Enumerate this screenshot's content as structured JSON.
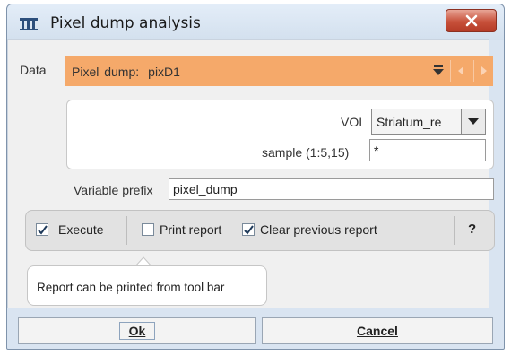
{
  "window": {
    "title": "Pixel dump analysis",
    "icon": "pmod-app-icon",
    "close_icon": "close-x-icon"
  },
  "data_row": {
    "label": "Data",
    "selector_prefix": "Pixel dump:",
    "selector_value": "pixD1",
    "accent_color": "#f5a96a"
  },
  "voi": {
    "label": "VOI",
    "value": "Striatum_re"
  },
  "sample": {
    "label": "sample (1:5,15)",
    "value": "*"
  },
  "prefix": {
    "label": "Variable prefix",
    "value": "pixel_dump"
  },
  "options": {
    "execute": {
      "label": "Execute",
      "checked": true
    },
    "print_report": {
      "label": "Print report",
      "checked": false
    },
    "clear_previous": {
      "label": "Clear previous report",
      "checked": true
    },
    "help": "?"
  },
  "tooltip": {
    "text": "Report can be printed from tool bar"
  },
  "buttons": {
    "ok": "Ok",
    "cancel": "Cancel"
  }
}
